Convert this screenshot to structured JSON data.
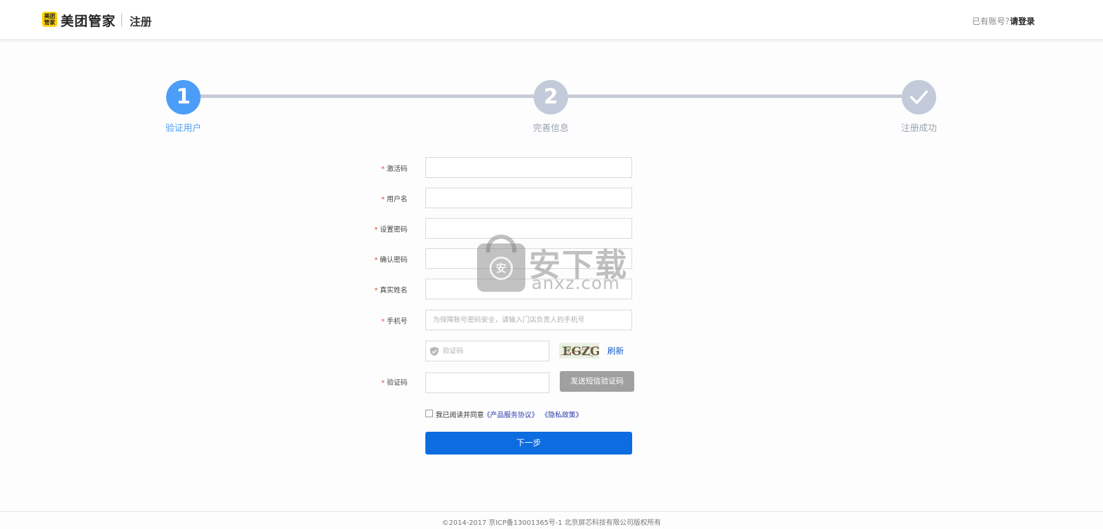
{
  "header": {
    "logo_text": "美团\n管家",
    "brand": "美团管家",
    "subtitle": "注册",
    "login_prompt": "已有账号？",
    "login_link": "请登录"
  },
  "steps": [
    {
      "number": "1",
      "label": "验证用户",
      "state": "active"
    },
    {
      "number": "2",
      "label": "完善信息",
      "state": "pending"
    },
    {
      "number": "",
      "label": "注册成功",
      "state": "pending",
      "icon": "check-icon"
    }
  ],
  "form": {
    "required_mark": "*",
    "fields": [
      {
        "label": "激活码",
        "value": "",
        "placeholder": ""
      },
      {
        "label": "用户名",
        "value": "",
        "placeholder": ""
      },
      {
        "label": "设置密码",
        "value": "",
        "placeholder": ""
      },
      {
        "label": "确认密码",
        "value": "",
        "placeholder": ""
      },
      {
        "label": "真实姓名",
        "value": "",
        "placeholder": ""
      },
      {
        "label": "手机号",
        "value": "",
        "placeholder": "为保障账号密码安全，请输入门店负责人的手机号"
      }
    ],
    "captcha": {
      "placeholder": "验证码",
      "image_text": "EGZG",
      "refresh_label": "刷新"
    },
    "sms": {
      "label": "验证码",
      "value": "",
      "button_label": "发送短信验证码"
    },
    "agreement": {
      "checked": false,
      "text": "我已阅读并同意",
      "link_terms": "《产品服务协议》",
      "link_privacy": "《隐私政策》"
    },
    "submit_label": "下一步"
  },
  "watermark": {
    "title": "安下载",
    "url": "anxz.com",
    "icon_glyph": "安"
  },
  "footer": {
    "copyright": "©2014-2017 京ICP备13001365号-1 北京屏芯科技有限公司版权所有"
  },
  "colors": {
    "accent": "#0d6ce0",
    "step_active": "#4c9df8",
    "step_inactive": "#c3cad9",
    "required": "#e0483a",
    "brand_yellow": "#ffd100"
  }
}
